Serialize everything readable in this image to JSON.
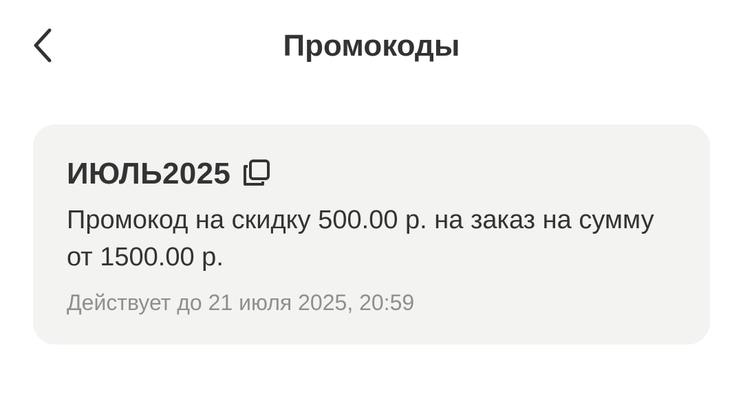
{
  "header": {
    "title": "Промокоды",
    "back_icon": "chevron-left-icon"
  },
  "promo": {
    "code": "ИЮЛЬ2025",
    "copy_icon": "copy-icon",
    "description": "Промокод на скидку 500.00 р. на заказ на сумму от 1500.00 р.",
    "validity": "Действует до 21 июля 2025, 20:59"
  },
  "colors": {
    "text_primary": "#333333",
    "text_secondary": "#8f8f8f",
    "card_background": "#f3f3f2",
    "page_background": "#ffffff"
  }
}
